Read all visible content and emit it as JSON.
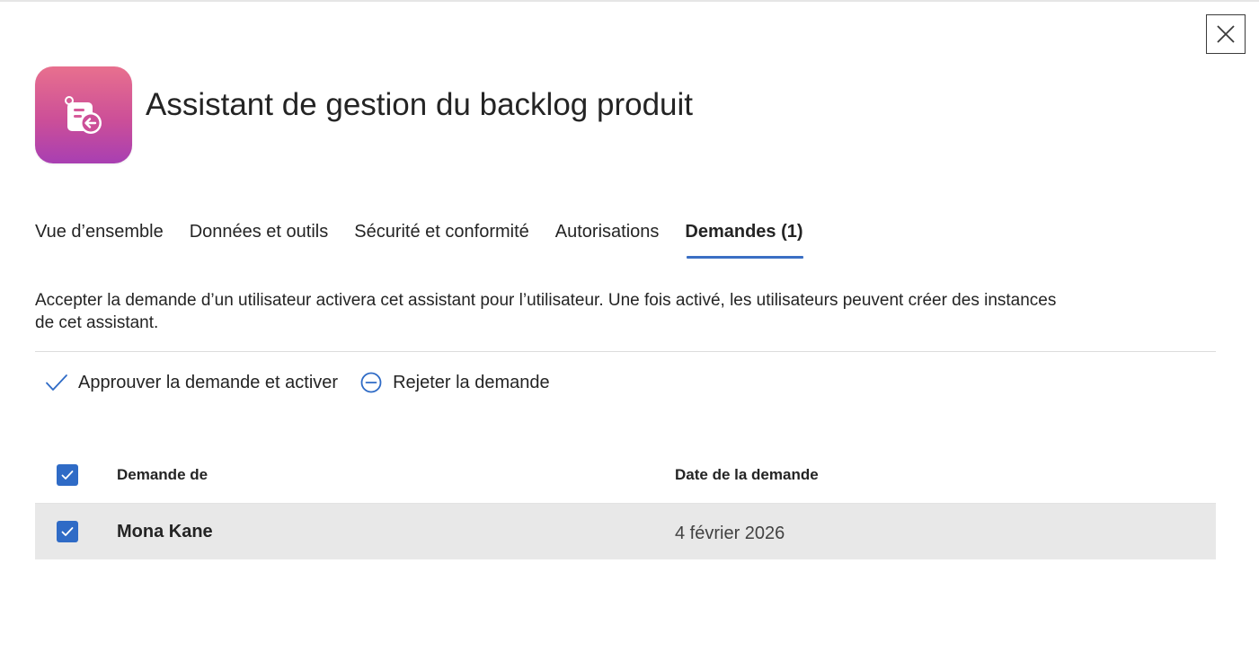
{
  "header": {
    "title": "Assistant de gestion du backlog produit",
    "close_label": "Fermer",
    "app_icon": "backlog-list-arrow-icon",
    "app_icon_gradient": [
      "#e8708e",
      "#cc4f98",
      "#a83fb2"
    ]
  },
  "tabs": [
    {
      "label": "Vue d’ensemble",
      "active": false
    },
    {
      "label": "Données et outils",
      "active": false
    },
    {
      "label": "Sécurité et conformité",
      "active": false
    },
    {
      "label": "Autorisations",
      "active": false
    },
    {
      "label": "Demandes (1)",
      "active": true
    }
  ],
  "description": "Accepter la demande d’un utilisateur activera cet assistant pour l’utilisateur. Une fois activé, les utilisateurs peuvent créer des instances de cet assistant.",
  "actions": {
    "approve_label": "Approuver la demande et activer",
    "reject_label": "Rejeter la demande",
    "icon_color": "#2f6bc6"
  },
  "table": {
    "columns": [
      "Demande de",
      "Date de la demande"
    ],
    "header_checked": true,
    "rows": [
      {
        "requester": "Mona Kane",
        "date": "4 février 2026",
        "checked": true
      }
    ]
  },
  "colors": {
    "accent": "#3a6fc4",
    "checkbox": "#2f6bc6",
    "selected_row": "#e8e8e8"
  }
}
